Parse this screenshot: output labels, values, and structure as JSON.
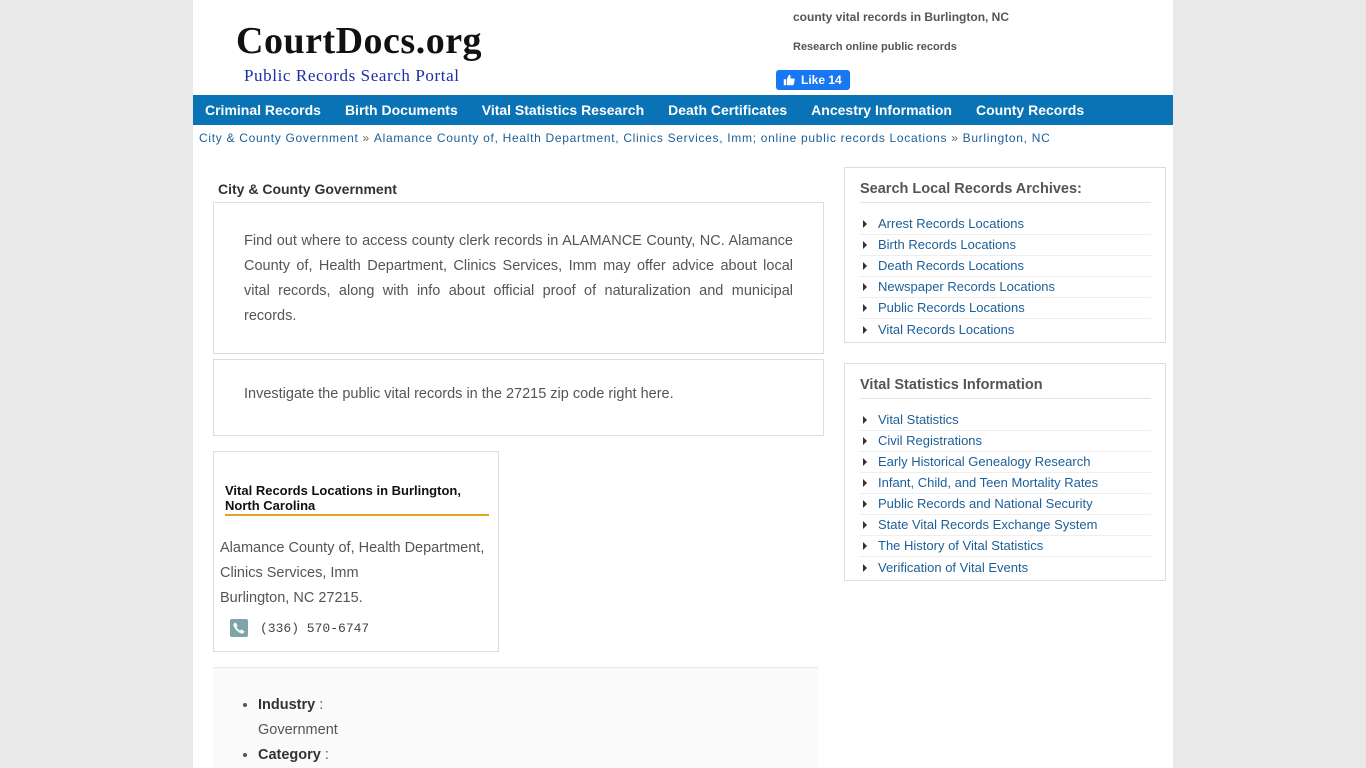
{
  "header": {
    "logo_title": "CourtDocs.org",
    "logo_subtitle": "Public Records Search Portal",
    "query": "county vital records in Burlington, NC",
    "tagline": "Research online public records",
    "like_label": "Like 14"
  },
  "nav": [
    {
      "label": "Criminal Records"
    },
    {
      "label": "Birth Documents"
    },
    {
      "label": "Vital Statistics Research"
    },
    {
      "label": "Death Certificates"
    },
    {
      "label": "Ancestry Information"
    },
    {
      "label": "County Records"
    }
  ],
  "breadcrumb": {
    "item1": "City & County Government",
    "item2": "Alamance County of, Health Department, Clinics Services, Imm; online public records Locations",
    "item3": "Burlington, NC",
    "separator": "»"
  },
  "main": {
    "section_title": "City & County Government",
    "description": "Find out where to access county clerk records in ALAMANCE County, NC. Alamance County of, Health Department, Clinics Services, Imm may offer advice about local vital records, along with info about official proof of naturalization and municipal records.",
    "zip_note": "Investigate the public vital records in the 27215 zip code right here.",
    "location_card": {
      "title": "Vital Records Locations in Burlington, North Carolina",
      "name_line1": "Alamance County of, Health Department,",
      "name_line2": "Clinics Services, Imm",
      "city_line": "Burlington, NC 27215.",
      "phone": "(336) 570-6747"
    },
    "meta": {
      "industry_label": "Industry",
      "industry_value": "Government",
      "category_label": "Category"
    }
  },
  "sidebar": {
    "archives": {
      "title": "Search Local Records Archives:",
      "items": [
        {
          "label": "Arrest Records Locations"
        },
        {
          "label": "Birth Records Locations"
        },
        {
          "label": "Death Records Locations"
        },
        {
          "label": "Newspaper Records Locations"
        },
        {
          "label": "Public Records Locations"
        },
        {
          "label": "Vital Records Locations"
        }
      ]
    },
    "vital": {
      "title": "Vital Statistics Information",
      "items": [
        {
          "label": "Vital Statistics"
        },
        {
          "label": "Civil Registrations"
        },
        {
          "label": "Early Historical Genealogy Research"
        },
        {
          "label": "Infant, Child, and Teen Mortality Rates"
        },
        {
          "label": "Public Records and National Security"
        },
        {
          "label": "State Vital Records Exchange System"
        },
        {
          "label": "The History of Vital Statistics"
        },
        {
          "label": "Verification of Vital Events"
        }
      ]
    }
  },
  "colors": {
    "nav_bg": "#0a73b6",
    "link": "#1c5f99",
    "accent_underline": "#e0a424",
    "facebook": "#1877f2"
  }
}
